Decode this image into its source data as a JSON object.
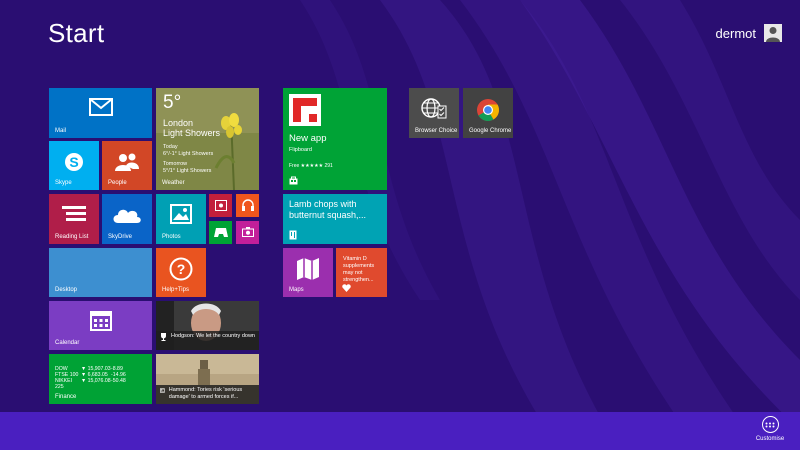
{
  "screen": {
    "title": "Start"
  },
  "user": {
    "name": "dermot",
    "icon": "user-avatar-icon"
  },
  "colors": {
    "background": "#2a0e72",
    "appbar": "#4a1fc0",
    "mail": "#0072c6",
    "skype": "#00aff0",
    "people": "#d24726",
    "reading_list": "#b01e49",
    "skydrive": "#0a64c8",
    "photos": "#00a0b4",
    "desktop": "#3d8fd0",
    "help": "#e95420",
    "calendar": "#7b3dc3",
    "finance": "#00a235",
    "flipboard": "#00a336",
    "food": "#00a3b4",
    "maps": "#9b2fae",
    "health": "#e04a2e",
    "camera": "#c21f64",
    "music": "#f0561d",
    "games": "#00a335",
    "browser_choice": "#4c4c4c",
    "chrome": "#424242"
  },
  "tiles": {
    "mail": {
      "label": "Mail",
      "icon": "envelope-icon"
    },
    "weather": {
      "label": "Weather",
      "temp": "5°",
      "city": "London",
      "condition": "Light Showers",
      "today_label": "Today",
      "today_value": "6°/-1° Light Showers",
      "tomorrow_label": "Tomorrow",
      "tomorrow_value": "5°/1° Light Showers"
    },
    "skype": {
      "label": "Skype",
      "icon": "skype-icon"
    },
    "people": {
      "label": "People",
      "icon": "people-icon"
    },
    "reading_list": {
      "label": "Reading List",
      "icon": "reading-list-icon"
    },
    "skydrive": {
      "label": "SkyDrive",
      "icon": "cloud-icon"
    },
    "photos": {
      "label": "Photos",
      "icon": "picture-icon"
    },
    "video": {
      "icon": "video-icon"
    },
    "music": {
      "icon": "headphones-icon"
    },
    "games": {
      "icon": "gamepad-icon"
    },
    "camera": {
      "icon": "camera-icon"
    },
    "desktop": {
      "label": "Desktop"
    },
    "help": {
      "label": "Help+Tips",
      "icon": "question-icon"
    },
    "calendar": {
      "label": "Calendar",
      "icon": "calendar-icon"
    },
    "sport": {
      "headline": "Hodgson: We let the country down",
      "icon": "trophy-icon"
    },
    "finance": {
      "label": "Finance",
      "rows": [
        {
          "name": "DOW",
          "value": "▼ 15,907.03",
          "change": "-8.89"
        },
        {
          "name": "FTSE 100",
          "value": "▼ 6,683.05",
          "change": "-14.96"
        },
        {
          "name": "NIKKEI 225",
          "value": "▼ 15,076.08",
          "change": "-50.48"
        }
      ]
    },
    "news": {
      "headline": "Hammond: Tories risk 'serious damage' to armed forces if...",
      "icon": "news-icon"
    },
    "flipboard": {
      "title": "New app",
      "subtitle": "Flipboard",
      "rating": "Free ★★★★★ 291",
      "store_icon": "store-bag-icon"
    },
    "food": {
      "headline": "Lamb chops with butternut squash,...",
      "icon": "food-icon"
    },
    "maps": {
      "label": "Maps",
      "icon": "map-icon"
    },
    "health": {
      "headline": "Vitamin D supplements may not strengthen...",
      "icon": "heart-icon"
    },
    "browser_choice": {
      "label": "Browser Choice",
      "icon": "globe-checklist-icon"
    },
    "chrome": {
      "label": "Google Chrome",
      "icon": "chrome-icon"
    }
  },
  "appbar": {
    "customise_label": "Customise",
    "icon": "ellipsis-icon"
  }
}
